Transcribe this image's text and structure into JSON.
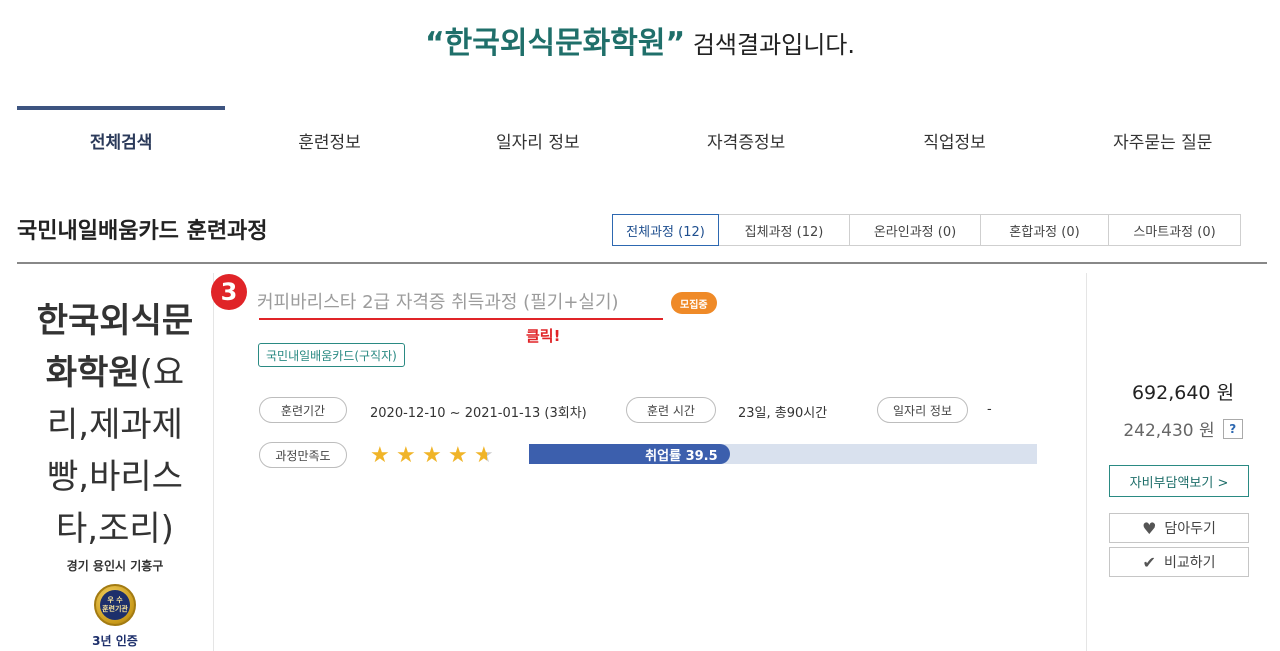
{
  "search": {
    "quoted_term": "“한국외식문화학원”",
    "suffix": " 검색결과입니다."
  },
  "tabs": [
    {
      "label": "전체검색",
      "active": true
    },
    {
      "label": "훈련정보"
    },
    {
      "label": "일자리 정보"
    },
    {
      "label": "자격증정보"
    },
    {
      "label": "직업정보"
    },
    {
      "label": "자주묻는 질문"
    }
  ],
  "section": {
    "title": "국민내일배움카드 훈련과정"
  },
  "filters": [
    {
      "label": "전체과정 (12)",
      "active": true
    },
    {
      "label": "집체과정 (12)"
    },
    {
      "label": "온라인과정 (0)"
    },
    {
      "label": "혼합과정 (0)"
    },
    {
      "label": "스마트과정 (0)"
    }
  ],
  "institution": {
    "name_bold": "한국외식문화학원",
    "name_rest": "(요리,제과제빵,바리스타,조리)",
    "location": "경기 용인시 기흥구",
    "badge_line1": "우 수",
    "badge_line2": "훈련기관",
    "certification": "3년 인증"
  },
  "course": {
    "step_number": "3",
    "title": "커피바리스타 2급 자격증 취득과정 (필기+실기)",
    "status_badge": "모집중",
    "click_hint": "클릭!",
    "card_type": "국민내일배움카드(구직자)",
    "period_label": "훈련기간",
    "period_value": "2020-12-10 ~ 2021-01-13 (3회차)",
    "hours_label": "훈련 시간",
    "hours_value": "23일, 총90시간",
    "jobs_label": "일자리 정보",
    "jobs_value": "-",
    "satisfaction_label": "과정만족도",
    "rating": 4.5,
    "rating_max": 5,
    "employment_text": "취업률 39.5",
    "employment_rate": 39.5
  },
  "pricing": {
    "price": "692,640 원",
    "self_pay": "242,430 원",
    "help": "?",
    "self_pay_button": "자비부담액보기 >",
    "save_button": "담아두기",
    "compare_button": "비교하기"
  },
  "colors": {
    "accent_teal": "#1f6f6a",
    "tab_active": "#3d5480",
    "step_red": "#e02428",
    "recruit_orange": "#ef8a28",
    "bar_fill": "#3c5fad",
    "bar_bg": "#d9e1ee",
    "star": "#f0b428"
  },
  "icons": {
    "save": "heart-icon",
    "compare": "check-icon",
    "rating": "star-icon"
  }
}
